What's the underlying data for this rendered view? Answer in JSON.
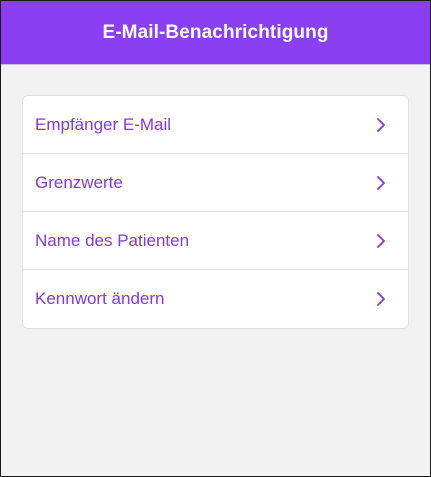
{
  "colors": {
    "accent": "#8a3ff0",
    "text_accent": "#8638d9",
    "background": "#f2f2f2"
  },
  "header": {
    "title": "E-Mail-Benachrichtigung"
  },
  "menu": {
    "items": [
      {
        "label": "Empfänger E-Mail",
        "icon": "chevron-right-icon"
      },
      {
        "label": "Grenzwerte",
        "icon": "chevron-right-icon"
      },
      {
        "label": "Name des Patienten",
        "icon": "chevron-right-icon"
      },
      {
        "label": "Kennwort ändern",
        "icon": "chevron-right-icon"
      }
    ]
  }
}
